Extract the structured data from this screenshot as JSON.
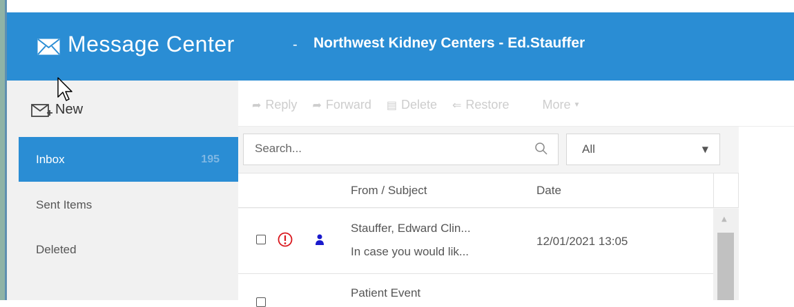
{
  "header": {
    "title": "Message Center",
    "separator": "-",
    "subtitle": "Northwest Kidney Centers - Ed.Stauffer",
    "icon": "envelope-icon",
    "color": "#2a8dd4"
  },
  "sidebar": {
    "new_label": "New",
    "items": [
      {
        "label": "Inbox",
        "count": "195",
        "active": true
      },
      {
        "label": "Sent Items"
      },
      {
        "label": "Deleted"
      }
    ]
  },
  "toolbar": {
    "reply": "Reply",
    "forward": "Forward",
    "delete": "Delete",
    "restore": "Restore",
    "more": "More"
  },
  "search": {
    "placeholder": "Search..."
  },
  "filter": {
    "value": "All"
  },
  "list": {
    "columns": {
      "from": "From / Subject",
      "date": "Date"
    },
    "rows": [
      {
        "from": "Stauffer, Edward Clin...",
        "subject": "In case you would lik...",
        "date": "12/01/2021 13:05",
        "urgent": true
      },
      {
        "from": "Patient Event",
        "subject": "",
        "date": ""
      }
    ]
  }
}
